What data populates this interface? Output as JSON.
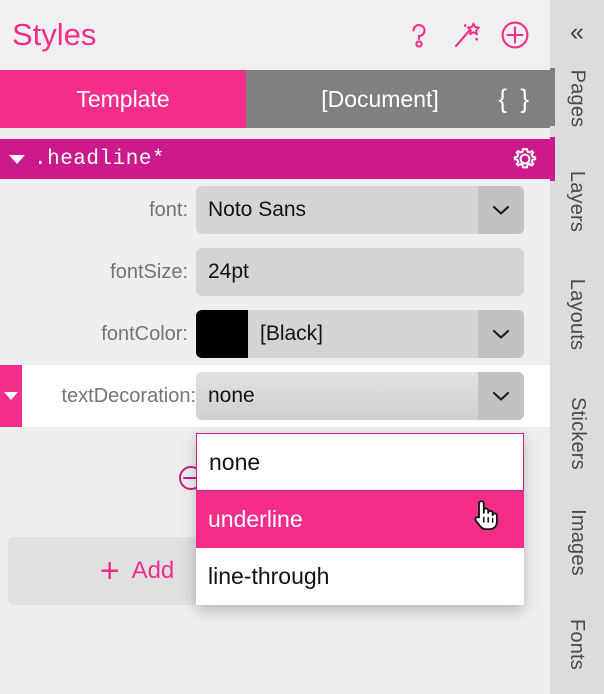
{
  "header": {
    "title": "Styles",
    "icons": [
      {
        "name": "help-icon",
        "glyph": "question-mark"
      },
      {
        "name": "magic-wand-icon",
        "glyph": "wand"
      },
      {
        "name": "add-style-icon",
        "glyph": "plus-circle"
      }
    ]
  },
  "tabs": {
    "template": "Template",
    "document": "[Document]",
    "code_braces": "{ }",
    "active": "Template"
  },
  "style_group": {
    "name": ".headline*",
    "expanded": true,
    "settings_icon": "gear-icon"
  },
  "properties": [
    {
      "label": "font:",
      "value": "Noto Sans",
      "control": "select",
      "active": false,
      "has_swatch": false
    },
    {
      "label": "fontSize:",
      "value": "24pt",
      "control": "text",
      "active": false,
      "has_swatch": false
    },
    {
      "label": "fontColor:",
      "value": "[Black]",
      "control": "select",
      "active": false,
      "has_swatch": true,
      "swatch_color": "#000000"
    },
    {
      "label": "textDecoration:",
      "value": "none",
      "control": "select",
      "active": true,
      "has_swatch": false
    }
  ],
  "dropdown": {
    "open": true,
    "options": [
      "none",
      "underline",
      "line-through"
    ],
    "highlighted": "underline",
    "current": "none"
  },
  "remove_button": {
    "name": "remove-property-button",
    "glyph": "minus-circle"
  },
  "add_button": {
    "plus": "+",
    "label": "Add"
  },
  "sidebar": {
    "collapse": "«",
    "items": [
      {
        "label": "Pages",
        "indicator": "gray"
      },
      {
        "label": "Layers",
        "indicator": "pink"
      },
      {
        "label": "Layouts",
        "indicator": "none"
      },
      {
        "label": "Stickers",
        "indicator": "none"
      },
      {
        "label": "Images",
        "indicator": "none"
      },
      {
        "label": "Fonts",
        "indicator": "none"
      }
    ]
  },
  "colors": {
    "accent_pink": "#f42d8a",
    "group_magenta": "#cc198c",
    "tab_inactive": "#808080",
    "panel_bg": "#eeeeee",
    "field_bg": "#d4d4d6",
    "sidebar_bg": "#dcdcdc"
  }
}
